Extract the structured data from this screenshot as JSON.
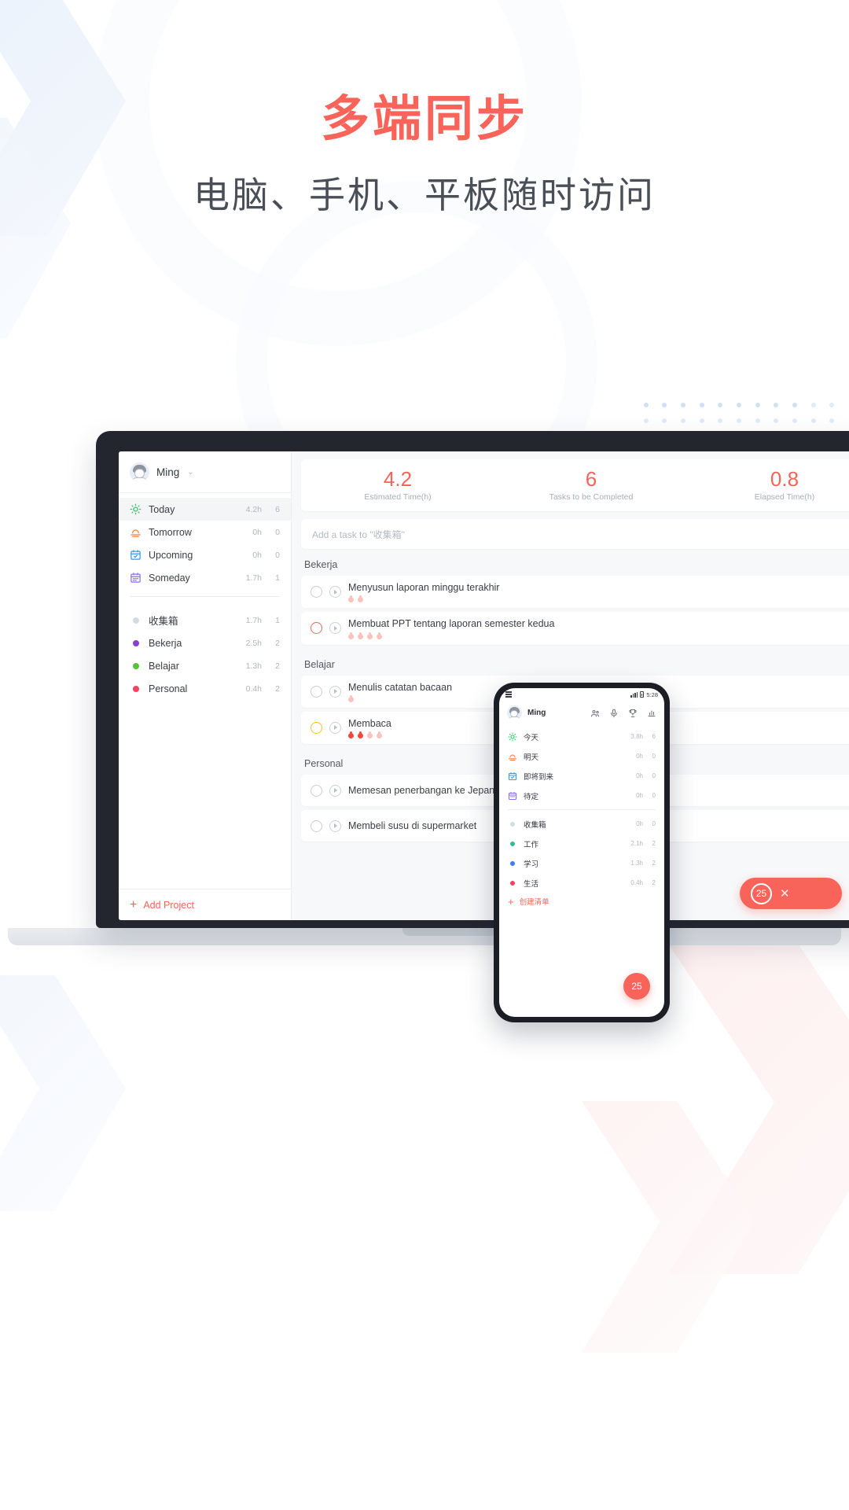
{
  "headline": {
    "title": "多端同步",
    "subtitle": "电脑、手机、平板随时访问",
    "title_color": "#f8635a",
    "subtitle_color": "#4a4f57"
  },
  "desktop": {
    "sidebar": {
      "user": {
        "name": "Ming",
        "caret": "⌄",
        "avatar": "user-avatar"
      },
      "smart_lists": [
        {
          "label": "Today",
          "icon": "sun-icon",
          "time": "4.2h",
          "count": "6",
          "active": true
        },
        {
          "label": "Tomorrow",
          "icon": "sunset-icon",
          "time": "0h",
          "count": "0",
          "active": false
        },
        {
          "label": "Upcoming",
          "icon": "calendar-check-icon",
          "time": "0h",
          "count": "0",
          "active": false
        },
        {
          "label": "Someday",
          "icon": "calendar-icon",
          "time": "1.7h",
          "count": "1",
          "active": false
        }
      ],
      "projects": [
        {
          "label": "收集箱",
          "color": "#d3dbe0",
          "time": "1.7h",
          "count": "1"
        },
        {
          "label": "Bekerja",
          "color": "#8b3fd4",
          "time": "2.5h",
          "count": "2"
        },
        {
          "label": "Belajar",
          "color": "#5bc236",
          "time": "1.3h",
          "count": "2"
        },
        {
          "label": "Personal",
          "color": "#f8425f",
          "time": "0.4h",
          "count": "2"
        }
      ],
      "add_project": "Add Project"
    },
    "stats": [
      {
        "value": "4.2",
        "caption": "Estimated Time(h)"
      },
      {
        "value": "6",
        "caption": "Tasks to be Completed"
      },
      {
        "value": "0.8",
        "caption": "Elapsed Time(h)"
      }
    ],
    "add_task_placeholder": "Add a task to \"收集箱\"",
    "groups": [
      {
        "title": "Bekerja",
        "tasks": [
          {
            "text": "Menyusun laporan minggu terakhir",
            "check": "gray",
            "tomatoes": [
              1,
              1
            ]
          },
          {
            "text": "Membuat PPT tentang laporan semester kedua",
            "check": "red",
            "tomatoes": [
              1,
              1,
              1,
              1
            ]
          }
        ]
      },
      {
        "title": "Belajar",
        "tasks": [
          {
            "text": "Menulis catatan bacaan",
            "check": "gray",
            "tomatoes": [
              1
            ]
          },
          {
            "text": "Membaca",
            "check": "yellow",
            "tomatoes": [
              2,
              2,
              1,
              1
            ]
          }
        ]
      },
      {
        "title": "Personal",
        "tasks": [
          {
            "text": "Memesan penerbangan ke Jepang",
            "check": "gray",
            "tomatoes": []
          },
          {
            "text": "Membeli susu di supermarket",
            "check": "gray",
            "tomatoes": []
          }
        ]
      }
    ],
    "pomodoro_button": {
      "minutes": "25",
      "close": "✕"
    }
  },
  "phone": {
    "status": {
      "time": "5:28",
      "signal": "signal-icon",
      "battery": "battery-icon",
      "qr": "qr-icon"
    },
    "header": {
      "name": "Ming",
      "icons": [
        "users-icon",
        "mic-icon",
        "trophy-icon",
        "stats-icon"
      ]
    },
    "smart_lists": [
      {
        "label": "今天",
        "icon": "sun-icon",
        "time": "3.8h",
        "count": "6"
      },
      {
        "label": "明天",
        "icon": "sunset-icon",
        "time": "0h",
        "count": "0"
      },
      {
        "label": "即将到来",
        "icon": "calendar-check-icon",
        "time": "0h",
        "count": "0"
      },
      {
        "label": "待定",
        "icon": "calendar-icon",
        "time": "0h",
        "count": "0"
      }
    ],
    "projects": [
      {
        "label": "收集箱",
        "color": "#d3dbe0",
        "time": "0h",
        "count": "0"
      },
      {
        "label": "工作",
        "color": "#2fbf8f",
        "time": "2.1h",
        "count": "2"
      },
      {
        "label": "学习",
        "color": "#3e7df5",
        "time": "1.3h",
        "count": "2"
      },
      {
        "label": "生活",
        "color": "#f8425f",
        "time": "0.4h",
        "count": "2"
      }
    ],
    "add_list": "创建清单",
    "fab": "25"
  }
}
